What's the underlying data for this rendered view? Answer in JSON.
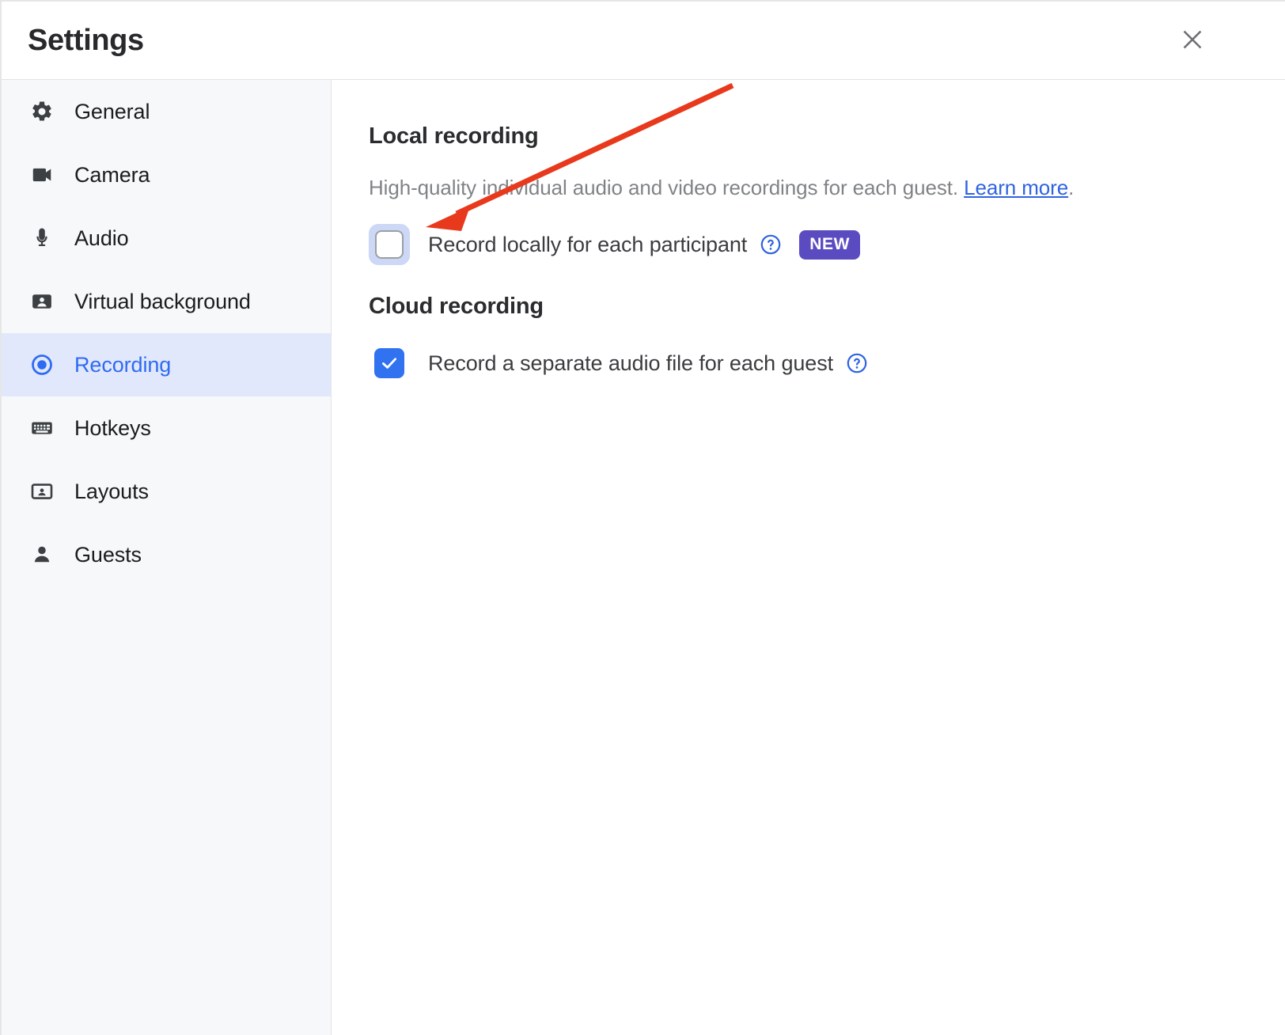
{
  "header": {
    "title": "Settings",
    "close_label": "Close",
    "close_icon": "close-icon"
  },
  "sidebar": {
    "items": [
      {
        "label": "General",
        "icon": "gear-icon",
        "active": false
      },
      {
        "label": "Camera",
        "icon": "video-camera-icon",
        "active": false
      },
      {
        "label": "Audio",
        "icon": "microphone-icon",
        "active": false
      },
      {
        "label": "Virtual background",
        "icon": "person-card-icon",
        "active": false
      },
      {
        "label": "Recording",
        "icon": "record-circle-icon",
        "active": true
      },
      {
        "label": "Hotkeys",
        "icon": "keyboard-icon",
        "active": false
      },
      {
        "label": "Layouts",
        "icon": "layout-frame-icon",
        "active": false
      },
      {
        "label": "Guests",
        "icon": "person-icon",
        "active": false
      }
    ]
  },
  "main": {
    "local": {
      "title": "Local recording",
      "description_before": "High-quality individual audio and video recordings for each guest. ",
      "link_text": "Learn more",
      "description_after": ".",
      "option_label": "Record locally for each participant",
      "checked": false,
      "help_icon": "help-circle-icon",
      "badge": "NEW"
    },
    "cloud": {
      "title": "Cloud recording",
      "option_label": "Record a separate audio file for each guest",
      "checked": true,
      "help_icon": "help-circle-icon"
    }
  },
  "annotation": {
    "type": "arrow",
    "color": "#e8391c",
    "description": "red arrow pointing to the local recording checkbox"
  },
  "colors": {
    "accent_blue": "#2f6bf2",
    "link_blue": "#2f63e0",
    "badge_purple": "#5b4bc0",
    "active_nav_bg": "#e1e8fc",
    "sidebar_bg": "#f7f8f9",
    "annotation_red": "#e8391c"
  }
}
